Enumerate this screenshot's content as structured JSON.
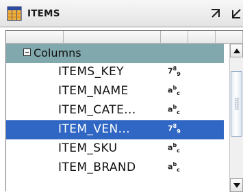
{
  "window": {
    "title": "ITEMS",
    "icon": "table-icon"
  },
  "titlebar_buttons": [
    {
      "icon": "maximize-arrow-icon"
    },
    {
      "icon": "minimize-arrow-icon"
    }
  ],
  "tree": {
    "group_label": "Columns",
    "group_expander_icon": "collapse-minus-icon",
    "rows": [
      {
        "name": "ITEMS_KEY",
        "type_icon": "numeric-type-icon",
        "type_text": "789",
        "selected": false
      },
      {
        "name": "ITEM_NAME",
        "type_icon": "string-type-icon",
        "type_text": "abc",
        "selected": false
      },
      {
        "name": "ITEM_CATE...",
        "type_icon": "string-type-icon",
        "type_text": "abc",
        "selected": false
      },
      {
        "name": "ITEM_VEN...",
        "type_icon": "numeric-type-icon",
        "type_text": "789",
        "selected": true
      },
      {
        "name": "ITEM_SKU",
        "type_icon": "string-type-icon",
        "type_text": "abc",
        "selected": false
      },
      {
        "name": "ITEM_BRAND",
        "type_icon": "string-type-icon",
        "type_text": "abc",
        "selected": false
      }
    ]
  },
  "colors": {
    "group_row": "#81a8ac",
    "selection": "#3167c4",
    "title_bg": "#e8e8e8"
  }
}
